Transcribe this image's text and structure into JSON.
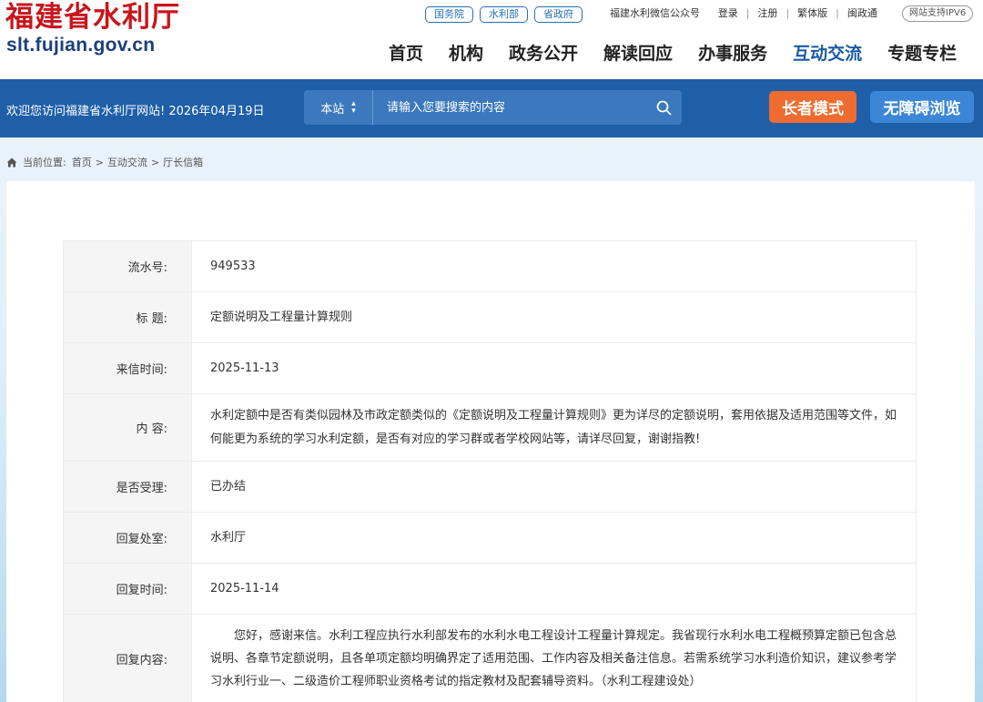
{
  "header": {
    "logo_cn": "福建省水利厅",
    "logo_en": "slt.fujian.gov.cn",
    "tags": [
      "国务院",
      "水利部",
      "省政府"
    ],
    "top_links": [
      "福建水利微信公众号",
      "登录",
      "注册",
      "繁体版",
      "闽政通"
    ],
    "ipv6": "网站支持IPV6",
    "nav": [
      "首页",
      "机构",
      "政务公开",
      "解读回应",
      "办事服务",
      "互动交流",
      "专题专栏"
    ],
    "active_nav": "互动交流"
  },
  "band": {
    "welcome": "欢迎您访问福建省水利厅网站! 2026年04月19日",
    "search_scope": "本站",
    "search_placeholder": "请输入您要搜索的内容",
    "elder_mode": "长者模式",
    "accessible": "无障碍浏览",
    "accent": "#1f5fa8"
  },
  "breadcrumb": {
    "prefix": "当前位置:",
    "items": [
      "首页",
      "互动交流",
      "厅长信箱"
    ],
    "separator": ">"
  },
  "detail": {
    "serial_label": "流水号:",
    "serial": "949533",
    "title_label": "标 题:",
    "title": "定额说明及工程量计算规则",
    "date_label": "来信时间:",
    "date": "2025-11-13",
    "content_label": "内 容:",
    "content": "水利定额中是否有类似园林及市政定额类似的《定额说明及工程量计算规则》更为详尽的定额说明，套用依据及适用范围等文件，如何能更为系统的学习水利定额，是否有对应的学习群或者学校网站等，请详尽回复，谢谢指教!",
    "accepted_label": "是否受理:",
    "accepted": "已办结",
    "office_label": "回复处室:",
    "office": "水利厅",
    "reply_date_label": "回复时间:",
    "reply_date": "2025-11-14",
    "reply_content_label": "回复内容:",
    "reply_content": "您好，感谢来信。水利工程应执行水利部发布的水利水电工程设计工程量计算规定。我省现行水利水电工程概预算定额已包含总说明、各章节定额说明，且各单项定额均明确界定了适用范围、工作内容及相关备注信息。若需系统学习水利造价知识，建议参考学习水利行业一、二级造价工程师职业资格考试的指定教材及配套辅导资料。（水利工程建设处）"
  }
}
